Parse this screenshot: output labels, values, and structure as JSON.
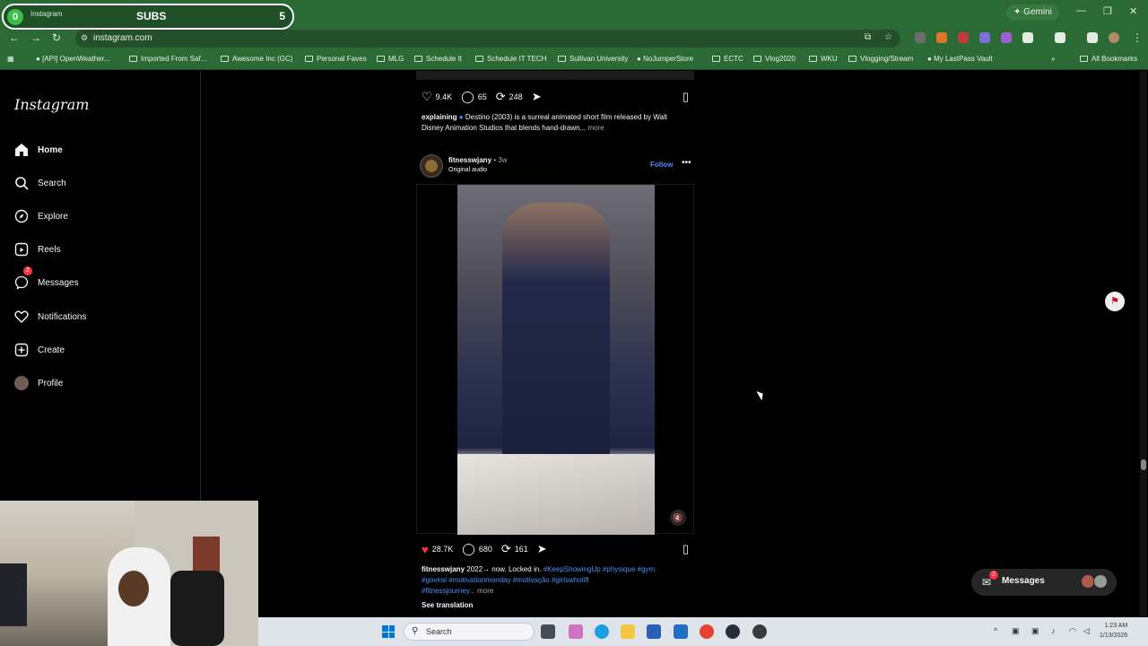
{
  "stream_overlay": {
    "left_count": "0",
    "tab_text": "Instagram",
    "label": "SUBS",
    "count": "5"
  },
  "browser": {
    "gemini_label": "Gemini",
    "url": "instagram.com",
    "bookmarks": [
      "[API] OpenWeather...",
      "Imported From Saf...",
      "Awesome Inc (GC)",
      "Personal Faves",
      "MLG",
      "Schedule It",
      "Schedule IT TECH",
      "Sullivan University",
      "NoJumperStore",
      "ECTC",
      "Vlog2020",
      "WKU",
      "Vlogging/Stream",
      "My LastPass Vault"
    ],
    "all_bookmarks": "All Bookmarks"
  },
  "instagram": {
    "logo": "Instagram",
    "nav": [
      {
        "label": "Home",
        "icon": "home-icon"
      },
      {
        "label": "Search",
        "icon": "search-icon"
      },
      {
        "label": "Explore",
        "icon": "compass-icon"
      },
      {
        "label": "Reels",
        "icon": "reels-icon"
      },
      {
        "label": "Messages",
        "icon": "messenger-icon",
        "badge": "2"
      },
      {
        "label": "Notifications",
        "icon": "heart-icon"
      },
      {
        "label": "Create",
        "icon": "plus-square-icon"
      },
      {
        "label": "Profile",
        "icon": "avatar"
      }
    ],
    "prev_post": {
      "likes": "9.4K",
      "comments": "65",
      "reposts": "248",
      "caption_user": "explaining",
      "caption_text": "Destino (2003) is a surreal animated short film released by Walt Disney Animation Studios that blends hand-drawn...",
      "more": "more"
    },
    "post": {
      "username": "fitnesswjany",
      "ago": "3w",
      "audio": "Original audio",
      "follow": "Follow",
      "likes": "28.7K",
      "comments": "680",
      "reposts": "161",
      "caption_user": "fitnesswjany",
      "caption_text": "2022→ now. Locked in.",
      "hashtags_line1": "#KeepShowingUp #physique #gym",
      "hashtags_line2": "#goviral #motivationmonday #motivação #girlswholift",
      "hashtags_line3": "#fitnessjourney...",
      "more": "more",
      "see_translation": "See translation"
    },
    "messages_pill": {
      "label": "Messages",
      "badge": "2"
    }
  },
  "taskbar": {
    "search_placeholder": "Search",
    "time": "1:23 AM",
    "date": "1/13/2026"
  },
  "colors": {
    "ig_link": "#4f8ef7",
    "like_red": "#ff3040",
    "chrome_green": "#2b6a35"
  }
}
